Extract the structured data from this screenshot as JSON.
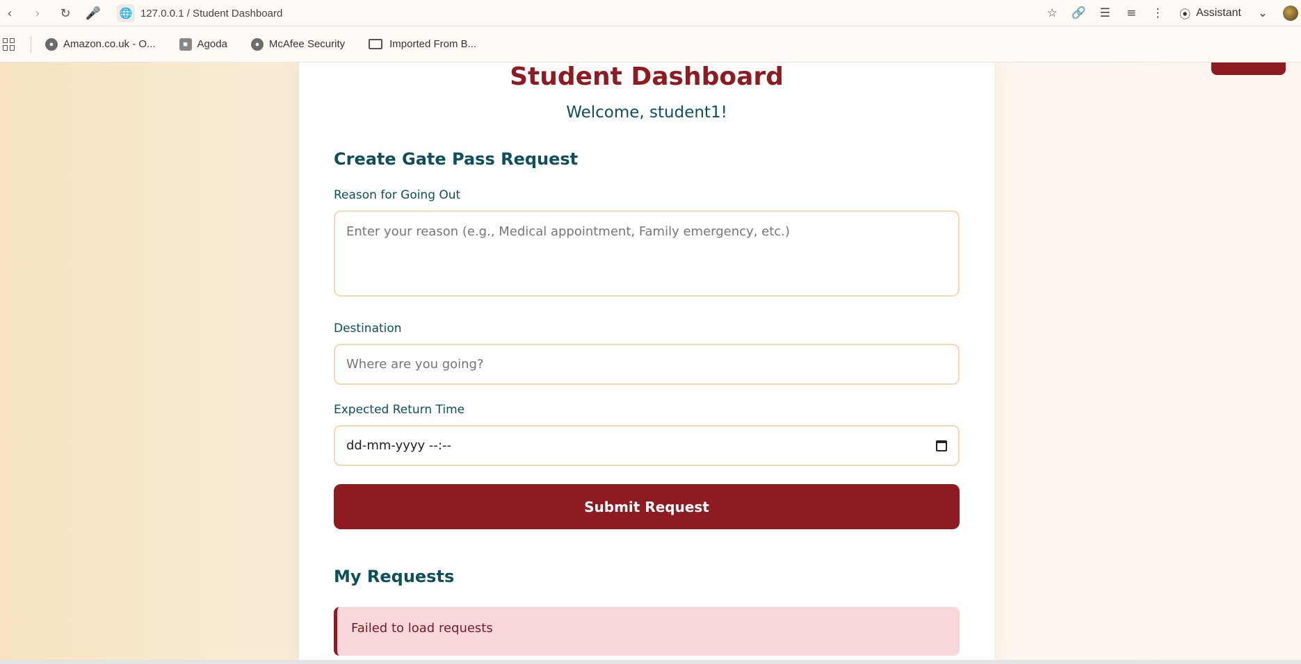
{
  "browser": {
    "url": "127.0.0.1 / Student Dashboard",
    "assistant_label": "Assistant",
    "bookmarks": [
      "Amazon.co.uk - O...",
      "Agoda",
      "McAfee Security",
      "Imported From B..."
    ]
  },
  "dashboard": {
    "title": "Student Dashboard",
    "welcome": "Welcome, student1!",
    "create_heading": "Create Gate Pass Request",
    "reason_label": "Reason for Going Out",
    "reason_placeholder": "Enter your reason (e.g., Medical appointment, Family emergency, etc.)",
    "destination_label": "Destination",
    "destination_placeholder": "Where are you going?",
    "return_label": "Expected Return Time",
    "return_placeholder": "dd-mm-yyyy --:--",
    "submit_label": "Submit Request",
    "requests_heading": "My Requests",
    "error_message": "Failed to load requests"
  },
  "colors": {
    "brand": "#8e1a22",
    "heading": "#0e4f5c",
    "input_border": "#f2d9b1",
    "alert_bg": "#f8d7da"
  },
  "icons": [
    "back-icon",
    "forward-icon",
    "reload-icon",
    "mic-icon",
    "globe-icon",
    "star-icon",
    "link-icon",
    "extensions-icon",
    "reading-list-icon",
    "voice-icon",
    "assistant-icon",
    "chevron-down-icon",
    "apps-icon",
    "folder-icon",
    "calendar-icon"
  ]
}
